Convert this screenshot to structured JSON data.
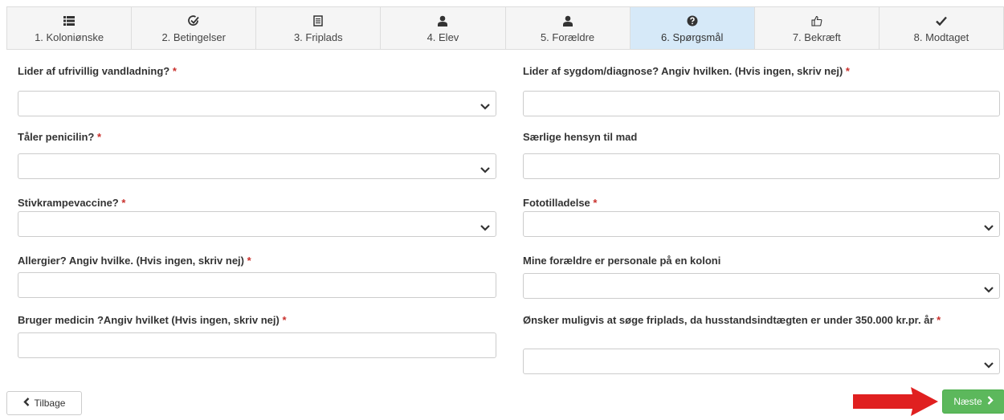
{
  "wizard": {
    "steps": [
      {
        "label": "1. Koloniønske",
        "icon": "list-icon"
      },
      {
        "label": "2. Betingelser",
        "icon": "check-circle-icon"
      },
      {
        "label": "3. Friplads",
        "icon": "document-icon"
      },
      {
        "label": "4. Elev",
        "icon": "user-icon"
      },
      {
        "label": "5. Forældre",
        "icon": "user-icon"
      },
      {
        "label": "6. Spørgsmål",
        "icon": "question-circle-icon",
        "active": true
      },
      {
        "label": "7. Bekræft",
        "icon": "thumbs-up-icon"
      },
      {
        "label": "8. Modtaget",
        "icon": "checkmark-icon"
      }
    ]
  },
  "form": {
    "left": [
      {
        "label": "Lider af ufrivillig vandladning?",
        "required": "*",
        "type": "select",
        "value": ""
      },
      {
        "label": "Tåler penicilin?",
        "required": "*",
        "type": "select",
        "value": ""
      },
      {
        "label": "Stivkrampevaccine?",
        "required": "*",
        "type": "select",
        "value": ""
      },
      {
        "label": "Allergier? Angiv hvilke. (Hvis ingen, skriv nej)",
        "required": "*",
        "type": "text",
        "value": ""
      },
      {
        "label": "Bruger medicin ?Angiv hvilket (Hvis ingen, skriv nej)",
        "required": "*",
        "type": "text",
        "value": ""
      }
    ],
    "right": [
      {
        "label": "Lider af sygdom/diagnose? Angiv hvilken. (Hvis ingen, skriv nej)",
        "required": "*",
        "type": "text",
        "value": ""
      },
      {
        "label": "Særlige hensyn til mad",
        "required": "",
        "type": "text",
        "value": ""
      },
      {
        "label": "Fototilladelse",
        "required": "*",
        "type": "select",
        "value": ""
      },
      {
        "label": "Mine forældre er personale på en koloni",
        "required": "",
        "type": "select",
        "value": ""
      },
      {
        "label": "Ønsker muligvis at søge friplads, da husstandsindtægten er under 350.000 kr.pr. år",
        "required": "*",
        "type": "select",
        "value": ""
      }
    ]
  },
  "buttons": {
    "back": "Tilbage",
    "next": "Næste"
  },
  "colors": {
    "active_step": "#d6e9f8",
    "required": "#c9302c",
    "next_button": "#5cb85c",
    "arrow": "#e02020"
  }
}
